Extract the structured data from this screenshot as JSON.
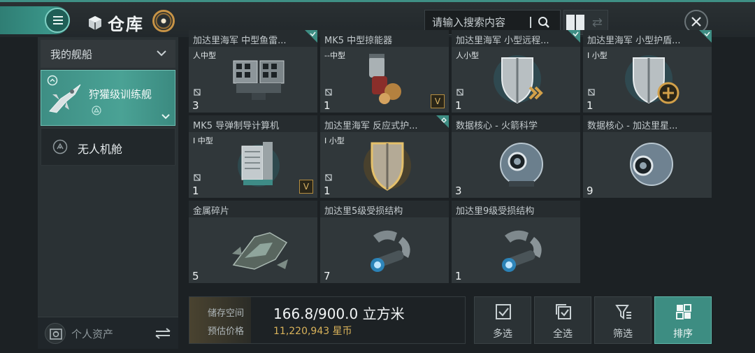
{
  "header": {
    "title": "仓库",
    "search_placeholder": "请输入搜索内容"
  },
  "sidebar": {
    "section_title": "我的舰船",
    "ship_name": "狩獾级训练舰",
    "drone_bay": "无人机舱",
    "footer_label": "个人资产"
  },
  "items": [
    {
      "name": "加达里海军 中型鱼雷...",
      "size": "中型",
      "qty": "3"
    },
    {
      "name": "MK5 中型掠能器",
      "size": "中型",
      "qty": "1",
      "badge": "V"
    },
    {
      "name": "加达里海军 小型远程...",
      "size": "小型",
      "qty": "1"
    },
    {
      "name": "加达里海军 小型护盾...",
      "size": "小型",
      "qty": "1"
    },
    {
      "name": "MK5 导弹制导计算机",
      "size": "中型",
      "qty": "1",
      "badge": "V"
    },
    {
      "name": "加达里海军 反应式护...",
      "size": "小型",
      "qty": "1"
    },
    {
      "name": "数据核心 - 火箭科学",
      "size": "",
      "qty": "3"
    },
    {
      "name": "数据核心 - 加达里星...",
      "size": "",
      "qty": "9"
    },
    {
      "name": "金属碎片",
      "size": "",
      "qty": "5"
    },
    {
      "name": "加达里5级受损结构",
      "size": "",
      "qty": "7"
    },
    {
      "name": "加达里9级受损结构",
      "size": "",
      "qty": "1"
    }
  ],
  "storage": {
    "space_label": "储存空间",
    "price_label": "预估价格",
    "space_value": "166.8/900.0 立方米",
    "price_value": "11,220,943 星币"
  },
  "actions": {
    "multi": "多选",
    "all": "全选",
    "filter": "筛选",
    "sort": "排序"
  },
  "colors": {
    "accent": "#3e8e84",
    "gold": "#d9b35a"
  }
}
